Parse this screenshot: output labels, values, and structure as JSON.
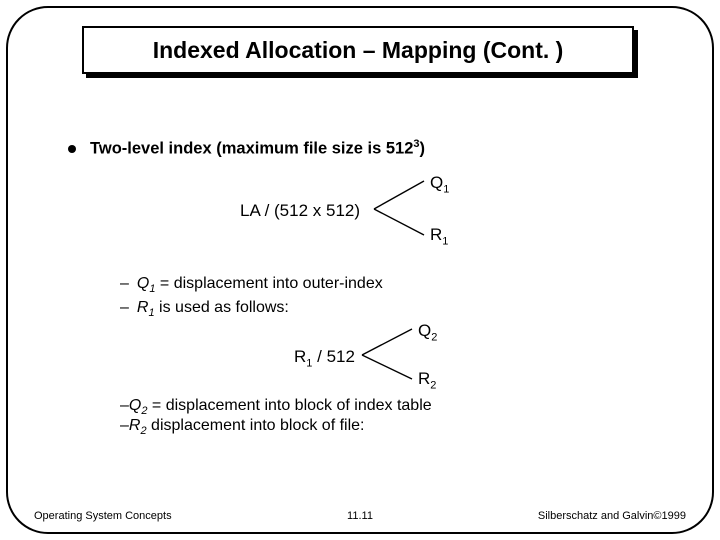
{
  "title": "Indexed Allocation – Mapping (Cont. )",
  "bullet": {
    "text_a": "Two-level index (maximum file size is 512",
    "exp": "3",
    "text_b": ")"
  },
  "formula1": {
    "lhs": "LA / (512 x 512)",
    "topvar": "Q",
    "topsub": "1",
    "botvar": "R",
    "botsub": "1"
  },
  "sub1": {
    "line1_var": "Q",
    "line1_sub": "1",
    "line1_rest": " = displacement into outer-index",
    "line2_var": "R",
    "line2_sub": "1",
    "line2_rest": " is used as follows:"
  },
  "formula2": {
    "lhs_a": "R",
    "lhs_sub": "1",
    "lhs_b": " / 512",
    "topvar": "Q",
    "topsub": "2",
    "botvar": "R",
    "botsub": "2"
  },
  "sub2": {
    "line1_var": "Q",
    "line1_sub": "2",
    "line1_rest": " = displacement into block of index table",
    "line2_var": "R",
    "line2_sub": "2",
    "line2_rest": " displacement into block of file:"
  },
  "footer": {
    "left": "Operating System Concepts",
    "center": "11.11",
    "right": "Silberschatz and Galvin©1999"
  }
}
